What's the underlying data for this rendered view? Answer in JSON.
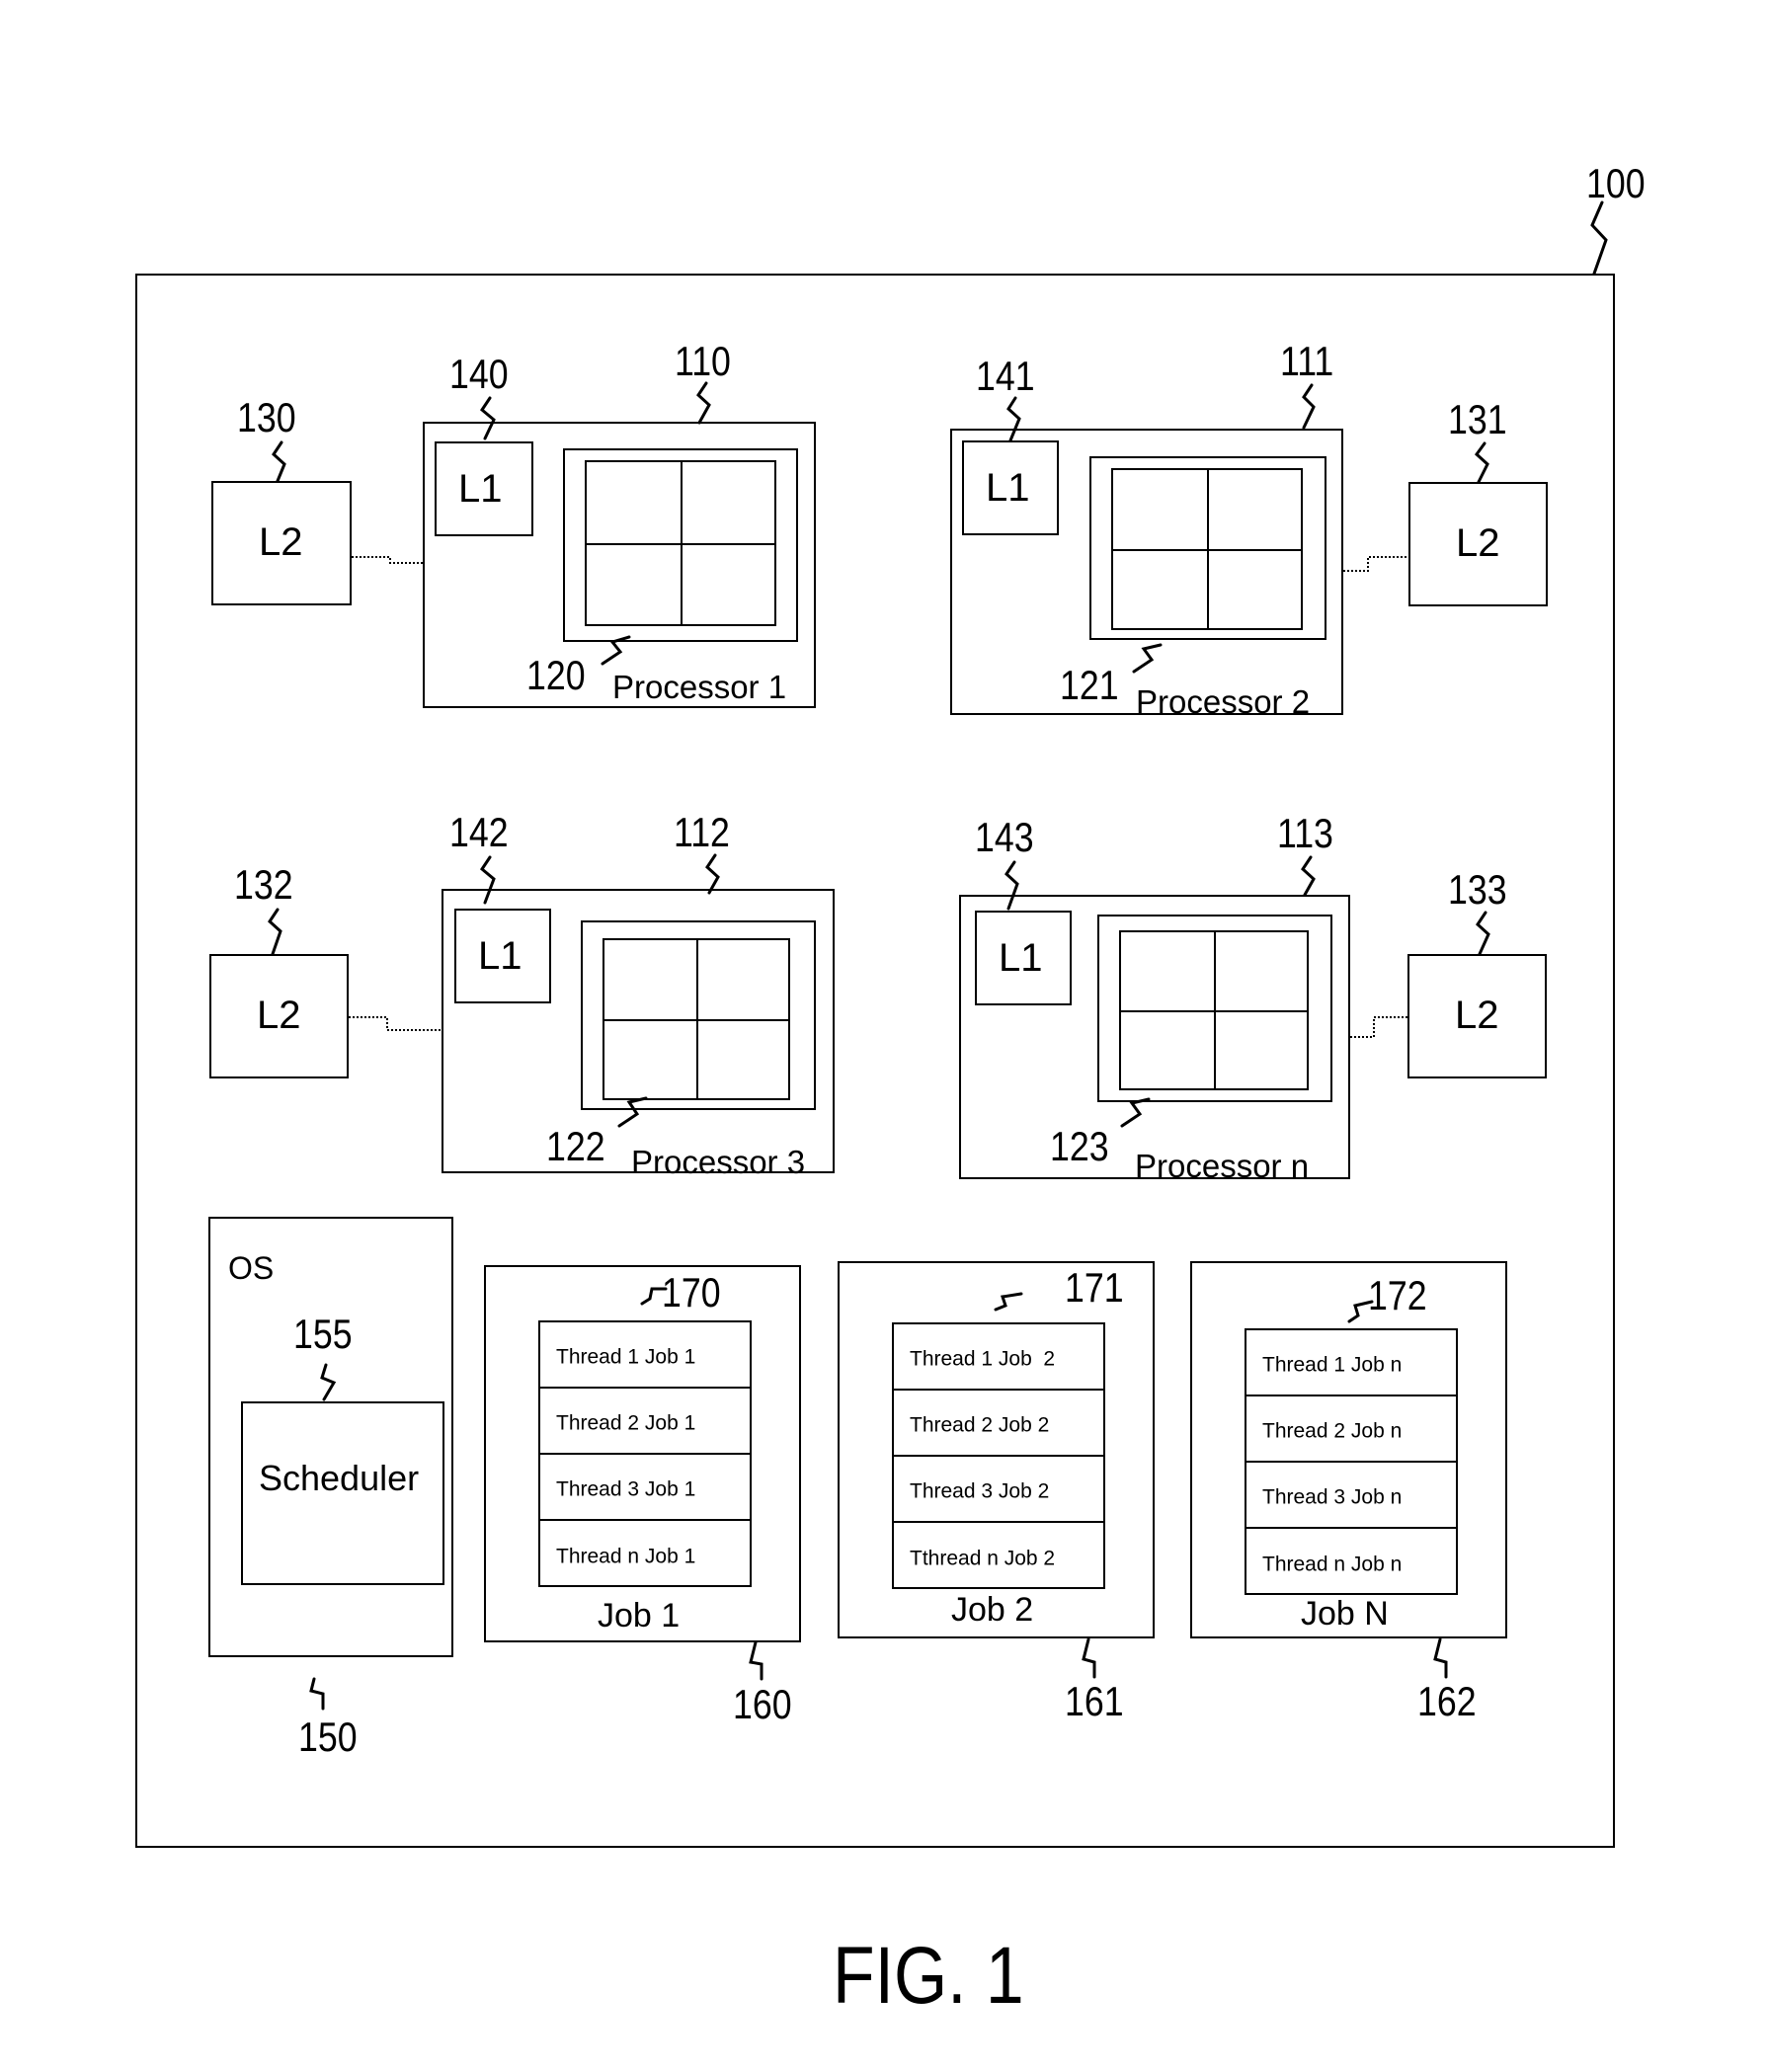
{
  "figure": {
    "caption": "FIG. 1",
    "system_ref": "100"
  },
  "processors": [
    {
      "name": "Processor 1",
      "ref": "110",
      "l1_label": "L1",
      "l1_ref": "140",
      "l2_label": "L2",
      "l2_ref": "130",
      "core_ref": "120",
      "l2_side": "left"
    },
    {
      "name": "Processor 2",
      "ref": "111",
      "l1_label": "L1",
      "l1_ref": "141",
      "l2_label": "L2",
      "l2_ref": "131",
      "core_ref": "121",
      "l2_side": "right"
    },
    {
      "name": "Processor 3",
      "ref": "112",
      "l1_label": "L1",
      "l1_ref": "142",
      "l2_label": "L2",
      "l2_ref": "132",
      "core_ref": "122",
      "l2_side": "left"
    },
    {
      "name": "Processor n",
      "ref": "113",
      "l1_label": "L1",
      "l1_ref": "143",
      "l2_label": "L2",
      "l2_ref": "133",
      "core_ref": "123",
      "l2_side": "right"
    }
  ],
  "os": {
    "label": "OS",
    "ref": "150",
    "scheduler_label": "Scheduler",
    "scheduler_ref": "155"
  },
  "jobs": [
    {
      "name": "Job 1",
      "ref": "160",
      "threads_ref": "170",
      "threads": [
        "Thread 1 Job 1",
        "Thread 2 Job 1",
        "Thread 3 Job 1",
        "Thread n Job 1"
      ]
    },
    {
      "name": "Job 2",
      "ref": "161",
      "threads_ref": "171",
      "threads": [
        "Thread 1 Job  2",
        "Thread 2 Job 2",
        "Thread 3 Job 2",
        "Tthread n Job 2"
      ]
    },
    {
      "name": "Job N",
      "ref": "162",
      "threads_ref": "172",
      "threads": [
        "Thread 1 Job n",
        "Thread 2 Job n",
        "Thread 3 Job n",
        "Thread n Job n"
      ]
    }
  ]
}
